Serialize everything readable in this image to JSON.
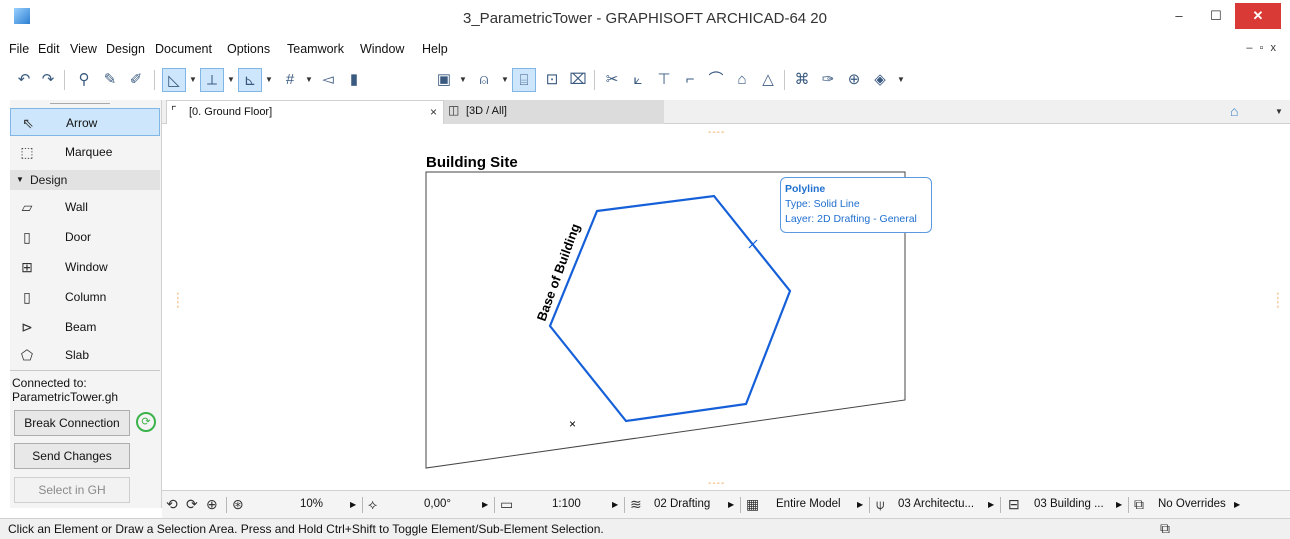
{
  "window": {
    "title": "3_ParametricTower - GRAPHISOFT ARCHICAD-64 20",
    "minimize": "–",
    "maximize": "☐",
    "close": "✕"
  },
  "menu": {
    "items": [
      "File",
      "Edit",
      "View",
      "Design",
      "Document",
      "Options",
      "Teamwork",
      "Window",
      "Help"
    ],
    "mdi_controls": "– ▫ x"
  },
  "toolbar": {
    "icons": [
      "undo-icon",
      "redo-icon",
      "find-select-icon",
      "eyedropper-icon",
      "syringe-icon",
      "trace-reference-icon",
      "guide-lines-icon",
      "snap-points-icon",
      "grid-snap-icon",
      "suspend-groups-icon",
      "layer-combination-icon",
      "lock-icon",
      "magic-wand-icon",
      "measure-icon",
      "offset-icon",
      "split-icon",
      "adjust-icon",
      "intersect-icon",
      "fillet-icon",
      "mirror-icon",
      "roof-icon",
      "teamwork-icon",
      "publish-icon",
      "render-icon"
    ]
  },
  "toolbox": {
    "tools_top": [
      {
        "label": "Arrow",
        "icon": "arrow-pointer-icon",
        "glyph": "⇖"
      },
      {
        "label": "Marquee",
        "icon": "marquee-icon",
        "glyph": "⬚"
      }
    ],
    "design_header": "Design",
    "design_tools": [
      {
        "label": "Wall",
        "icon": "wall-icon",
        "glyph": "▱"
      },
      {
        "label": "Door",
        "icon": "door-icon",
        "glyph": "▯"
      },
      {
        "label": "Window",
        "icon": "window-icon",
        "glyph": "⊞"
      },
      {
        "label": "Column",
        "icon": "column-icon",
        "glyph": "▯"
      },
      {
        "label": "Beam",
        "icon": "beam-icon",
        "glyph": "⊳"
      },
      {
        "label": "Slab",
        "icon": "slab-icon",
        "glyph": "⬠"
      }
    ],
    "connected_label": "Connected to:",
    "connected_file": "ParametricTower.gh",
    "break_connection": "Break Connection",
    "send_changes": "Send Changes",
    "select_in_gh": "Select in GH"
  },
  "tabs": [
    {
      "label": "[0. Ground Floor]",
      "close": "×"
    },
    {
      "label": "[3D / All]"
    }
  ],
  "canvas": {
    "drawing_title": "Building Site",
    "annotation": "Base of Building",
    "hexagon_color": "#1560d8",
    "tooltip": {
      "title": "Polyline",
      "type": "Type: Solid Line",
      "layer": "Layer: 2D Drafting - General"
    }
  },
  "navbar": {
    "zoom": "10%",
    "angle": "0,00°",
    "scale": "1:100",
    "layer_combo": "02 Drafting",
    "model_view": "Entire Model",
    "pen_set": "03 Architectu...",
    "dimension": "03 Building ...",
    "overrides": "No Overrides"
  },
  "status": {
    "text": "Click an Element or Draw a Selection Area. Press and Hold Ctrl+Shift to Toggle Element/Sub-Element Selection."
  }
}
